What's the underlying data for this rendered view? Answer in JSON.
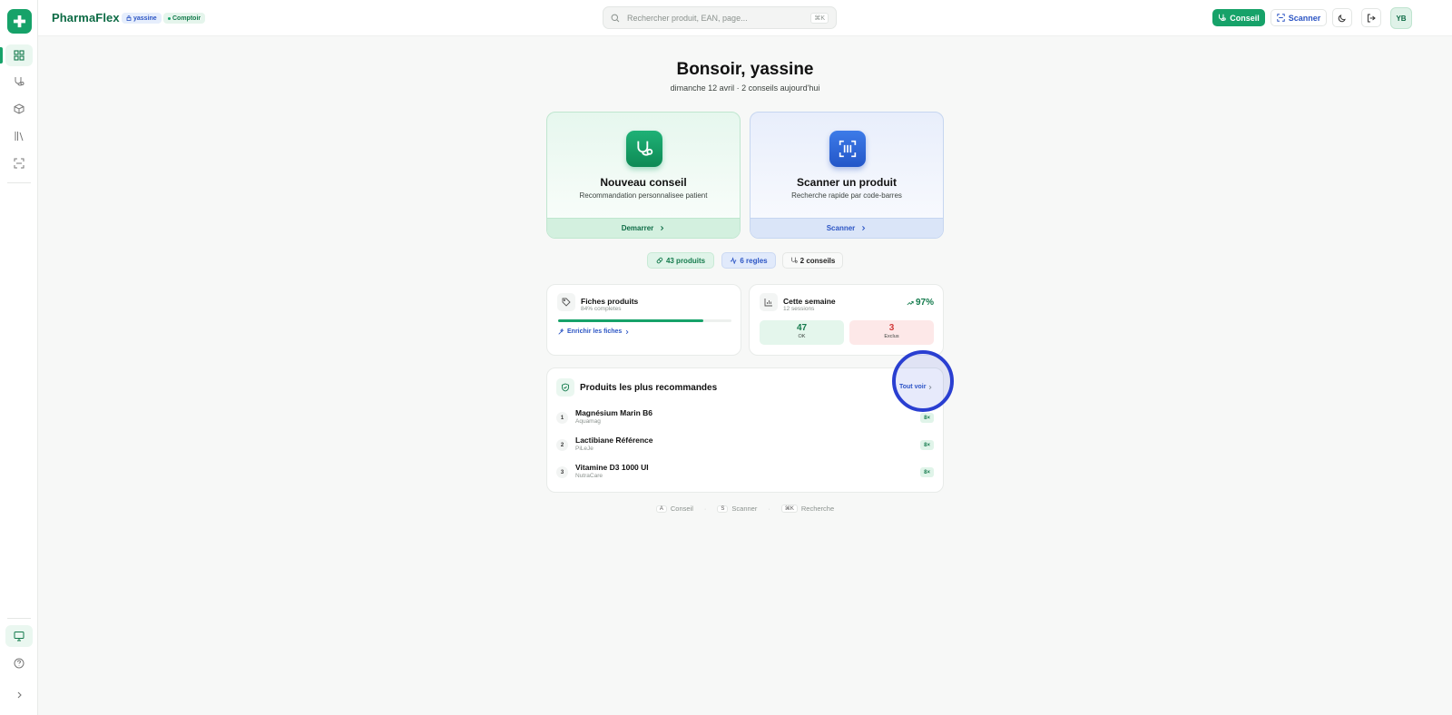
{
  "app": {
    "brand": "PharmaFlex",
    "user_badge": "yassine",
    "mode_badge": "Comptoir",
    "accent": "#16a269",
    "accent_blue": "#2c55c4"
  },
  "search": {
    "placeholder": "Rechercher produit, EAN, page...",
    "shortcut": "⌘K"
  },
  "topbar": {
    "conseil_label": "Conseil",
    "scanner_label": "Scanner",
    "avatar_initials": "YB"
  },
  "sidebar": {
    "items": [
      {
        "name": "dashboard-icon",
        "active": true
      },
      {
        "name": "stethoscope-icon"
      },
      {
        "name": "package-icon"
      },
      {
        "name": "library-icon"
      },
      {
        "name": "scan-icon"
      }
    ],
    "bottom": [
      {
        "name": "monitor-icon",
        "active": true
      },
      {
        "name": "help-icon"
      },
      {
        "name": "chevron-right-icon"
      }
    ]
  },
  "greeting": {
    "title": "Bonsoir, yassine",
    "subtitle": "dimanche 12 avril · 2 conseils aujourd'hui"
  },
  "cards": {
    "conseil": {
      "title": "Nouveau conseil",
      "subtitle": "Recommandation personnalisee patient",
      "action": "Demarrer"
    },
    "scanner": {
      "title": "Scanner un produit",
      "subtitle": "Recherche rapide par code-barres",
      "action": "Scanner"
    }
  },
  "pills": {
    "produits": "43 produits",
    "regles": "6 regles",
    "conseils": "2 conseils"
  },
  "fiches": {
    "title": "Fiches produits",
    "subtitle": "84% completes",
    "progress": 0.84,
    "link": "Enrichir les fiches"
  },
  "semaine": {
    "title": "Cette semaine",
    "subtitle": "12 sessions",
    "trend": "97%",
    "ok_value": "47",
    "ok_label": "OK",
    "exclus_value": "3",
    "exclus_label": "Exclus"
  },
  "reco": {
    "title": "Produits les plus recommandes",
    "see_all": "Tout voir",
    "items": [
      {
        "rank": "1",
        "name": "Magnésium Marin B6",
        "brand": "Aquamag",
        "count": "8×"
      },
      {
        "rank": "2",
        "name": "Lactibiane Référence",
        "brand": "PiLeJe",
        "count": "8×"
      },
      {
        "rank": "3",
        "name": "Vitamine D3 1000 UI",
        "brand": "NutraCare",
        "count": "8×"
      }
    ]
  },
  "shortcuts": [
    {
      "key": "A",
      "label": "Conseil"
    },
    {
      "key": "S",
      "label": "Scanner"
    },
    {
      "key": "⌘K",
      "label": "Recherche"
    }
  ]
}
